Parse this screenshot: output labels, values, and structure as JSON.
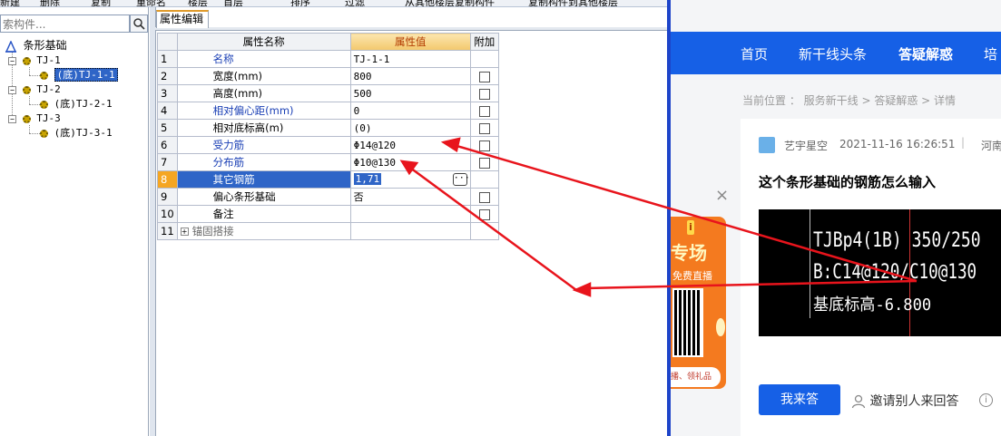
{
  "toolbar": {
    "items": [
      "新建",
      "删除",
      "复制",
      "重命名",
      "楼层",
      "首层",
      "排序",
      "过滤",
      "从其他楼层复制构件",
      "复制构件到其他楼层"
    ]
  },
  "tree": {
    "search_placeholder": "索构件...",
    "root": "条形基础",
    "nodes": [
      {
        "label": "TJ-1",
        "child": "(底)TJ-1-1",
        "selected": true
      },
      {
        "label": "TJ-2",
        "child": "(底)TJ-2-1",
        "selected": false
      },
      {
        "label": "TJ-3",
        "child": "(底)TJ-3-1",
        "selected": false
      }
    ]
  },
  "props": {
    "tab": "属性编辑",
    "headers": {
      "name": "属性名称",
      "value": "属性值",
      "extra": "附加"
    },
    "rows": [
      {
        "n": "1",
        "name": "名称",
        "value": "TJ-1-1",
        "blue": true,
        "chk": false
      },
      {
        "n": "2",
        "name": "宽度(mm)",
        "value": "800",
        "blue": false,
        "chk": true
      },
      {
        "n": "3",
        "name": "高度(mm)",
        "value": "500",
        "blue": false,
        "chk": true
      },
      {
        "n": "4",
        "name": "相对偏心距(mm)",
        "value": "0",
        "blue": true,
        "chk": true
      },
      {
        "n": "5",
        "name": "相对底标高(m)",
        "value": "(0)",
        "blue": false,
        "chk": true
      },
      {
        "n": "6",
        "name": "受力筋",
        "value": "Φ14@120",
        "blue": true,
        "chk": true
      },
      {
        "n": "7",
        "name": "分布筋",
        "value": "Φ10@130",
        "blue": true,
        "chk": true
      },
      {
        "n": "8",
        "name": "其它钢筋",
        "value": "1,71",
        "blue": true,
        "chk": false,
        "selected": true
      },
      {
        "n": "9",
        "name": "偏心条形基础",
        "value": "否",
        "blue": false,
        "chk": true
      },
      {
        "n": "10",
        "name": "备注",
        "value": "",
        "blue": false,
        "chk": true
      },
      {
        "n": "11",
        "name": "锚固搭接",
        "value": "",
        "blue": false,
        "chk": false,
        "group": true
      }
    ]
  },
  "web": {
    "nav": [
      "首页",
      "新干线头条",
      "答疑解惑",
      "培"
    ],
    "breadcrumb": "当前位置 ： 服务新干线 > 答疑解惑 > 详情",
    "author": "艺宇星空",
    "time": "2021-11-16 16:26:51",
    "separator": "|",
    "region": "河南",
    "question_title": "这个条形基础的钢筋怎么输入",
    "cad_lines": [
      "TJBp4(1B) 350/250",
      "B:C14@120/C10@130",
      "基底标高-6.800"
    ],
    "answer_button": "我来答",
    "invite": "邀请别人来回答",
    "info_icon": "i",
    "close": "×",
    "ad": {
      "badge": "i",
      "title": "专场",
      "sub": "免费直播",
      "foot": "播、领礼品"
    }
  },
  "colors": {
    "nav_blue": "#1660e6",
    "arrow_red": "#e8141c",
    "selection_blue": "#2f65c7",
    "header_orange": "#f3c86c"
  }
}
